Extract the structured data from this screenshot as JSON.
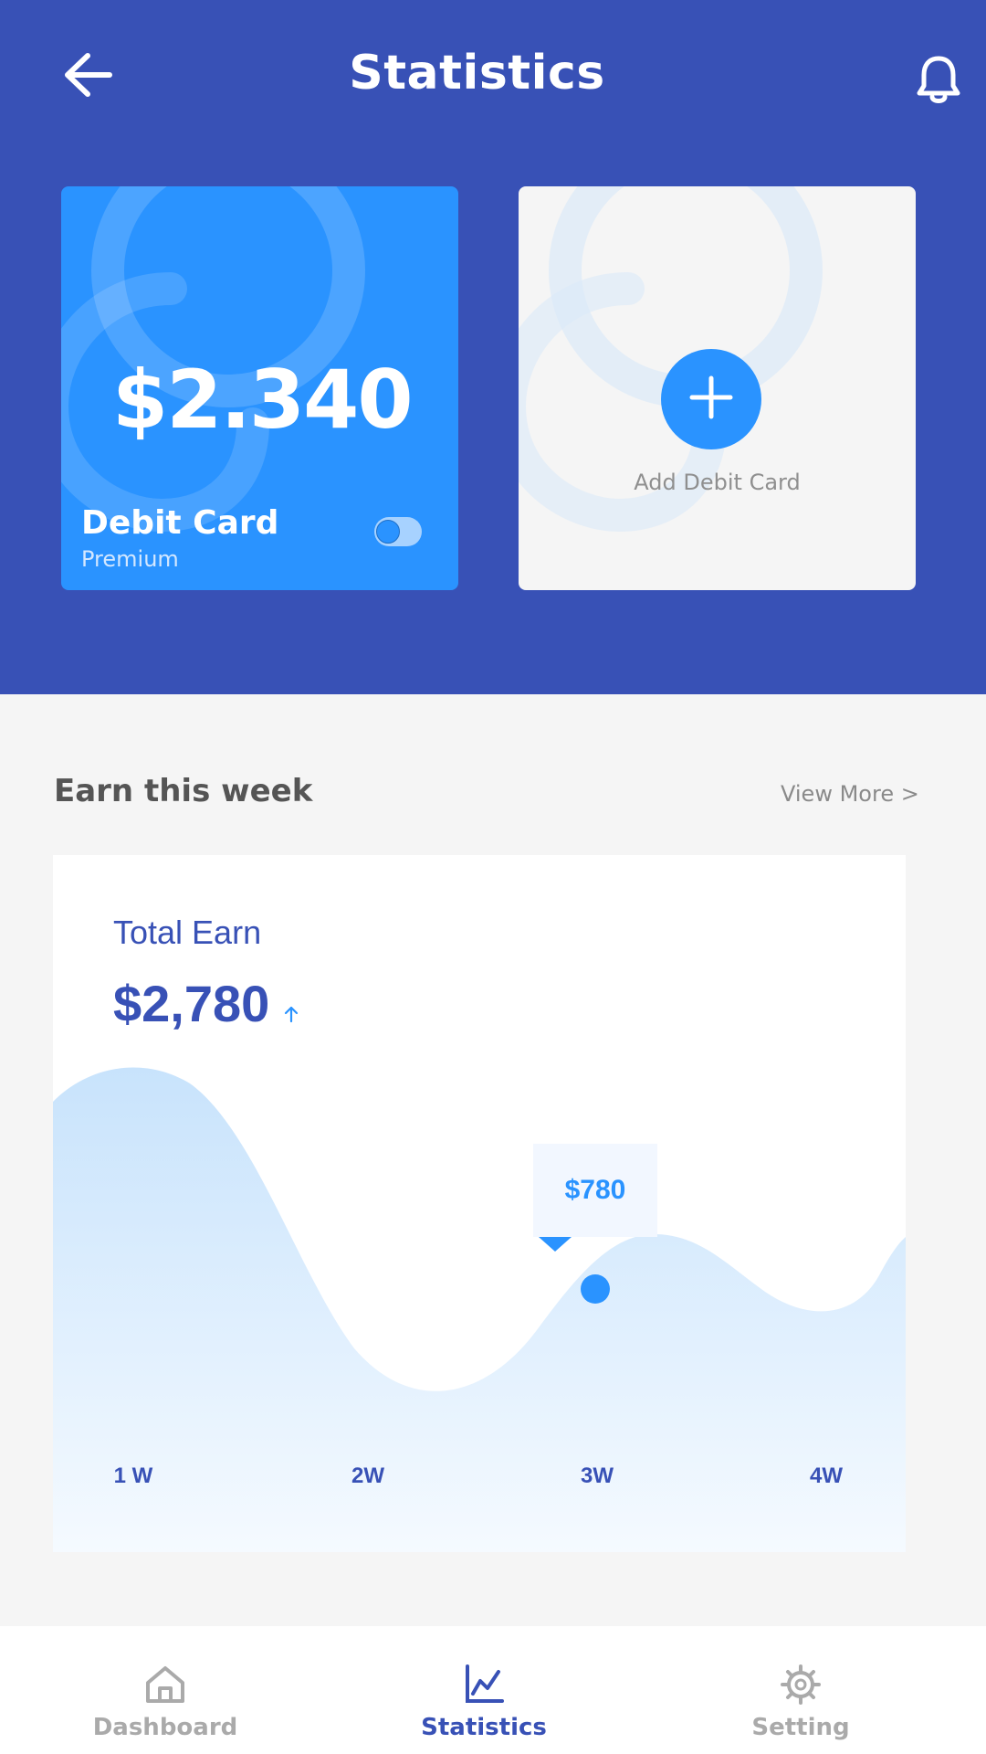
{
  "header": {
    "title": "Statistics",
    "back_icon": "arrow-left-icon",
    "bell_icon": "bell-icon",
    "background": "#3851b6"
  },
  "cards": {
    "debit": {
      "amount": "$2.340",
      "name": "Debit Card",
      "tier": "Premium",
      "color": "#2a93ff",
      "toggle_on": false
    },
    "add": {
      "label": "Add Debit Card",
      "icon": "plus-icon"
    }
  },
  "earn": {
    "section_title": "Earn this week",
    "view_more": "View More >",
    "total_label": "Total Earn",
    "total_value": "$2,780",
    "trend_icon": "arrow-up-icon",
    "tooltip_value": "$780",
    "highlight_index": 2,
    "x_labels": [
      "1 W",
      "2W",
      "3W",
      "4W"
    ]
  },
  "nav": {
    "items": [
      {
        "label": "Dashboard",
        "icon": "home-icon",
        "active": false
      },
      {
        "label": "Statistics",
        "icon": "chart-icon",
        "active": true
      },
      {
        "label": "Setting",
        "icon": "gear-icon",
        "active": false
      }
    ],
    "active_color": "#3851b6",
    "inactive_color": "#aaaaaa"
  }
}
